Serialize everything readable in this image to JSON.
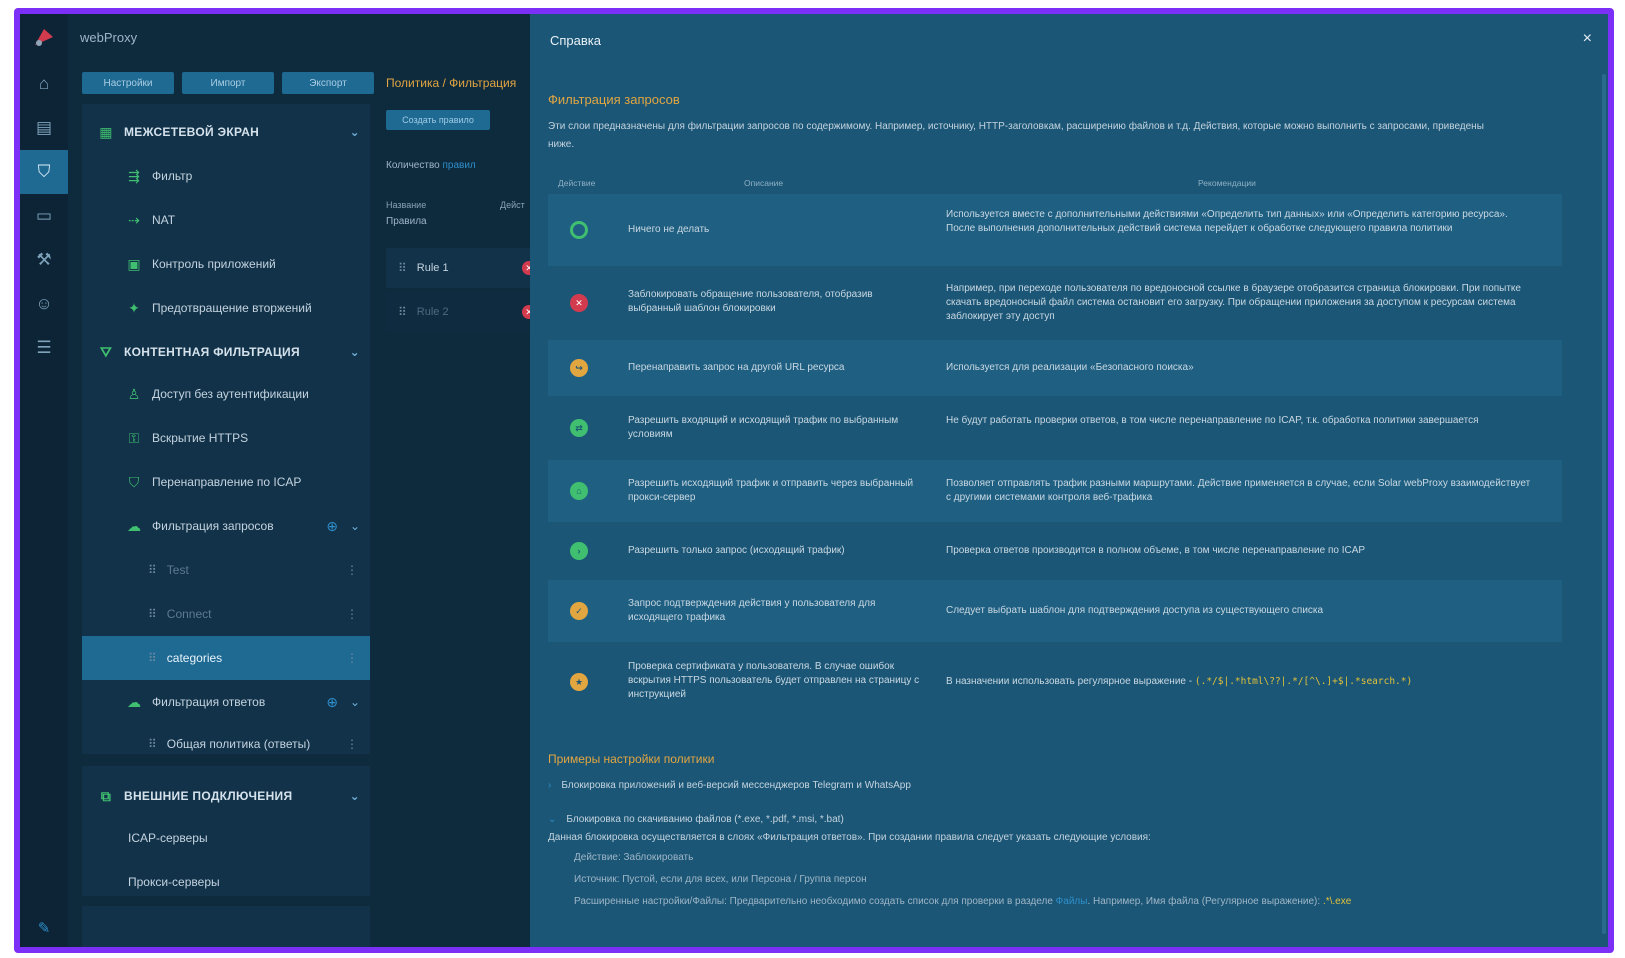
{
  "app": {
    "title": "webProxy"
  },
  "toolbar": {
    "settings": "Настройки",
    "import": "Импорт",
    "export": "Экспорт"
  },
  "nav": {
    "firewall": "МЕЖСЕТЕВОЙ ЭКРАН",
    "filter": "Фильтр",
    "nat": "NAT",
    "app_control": "Контроль приложений",
    "ips": "Предотвращение вторжений",
    "content_filter": "КОНТЕНТНАЯ ФИЛЬТРАЦИЯ",
    "no_auth": "Доступ без аутентификации",
    "https": "Вскрытие HTTPS",
    "icap": "Перенаправление по ICAP",
    "req_filter": "Фильтрация запросов",
    "rule_test": "Test",
    "rule_connect": "Connect",
    "rule_categories": "categories",
    "resp_filter": "Фильтрация ответов",
    "common_policy": "Общая политика (ответы)",
    "ext": "ВНЕШНИЕ ПОДКЛЮЧЕНИЯ",
    "icap_servers": "ICAP-серверы",
    "proxy_servers": "Прокси-серверы"
  },
  "middle": {
    "breadcrumb": "Политика / Фильтрация",
    "create_rule": "Создать правило",
    "count_label": "Количество",
    "count_link": "правил",
    "col_name": "Название",
    "col_action": "Дейст",
    "rules_label": "Правила",
    "rule1": "Rule 1",
    "rule2": "Rule 2"
  },
  "help": {
    "title": "Справка",
    "close": "×",
    "section": "Фильтрация запросов",
    "intro": "Эти слои предназначены для фильтрации запросов по содержимому. Например, источнику, HTTP-заголовкам, расширению файлов и т.д. Действия, которые можно выполнить с запросами, приведены ниже.",
    "th_action": "Действие",
    "th_desc": "Описание",
    "th_rec": "Рекомендации",
    "rows": [
      {
        "icon": "circle-icon",
        "color": "#3fbf6f",
        "desc": "Ничего не делать",
        "rec": "Используется вместе с дополнительными действиями «Определить тип данных» или «Определить категорию ресурса». После выполнения дополнительных действий система перейдет к обработке следующего правила политики"
      },
      {
        "icon": "block-icon",
        "color": "#d23b4e",
        "desc": "Заблокировать обращение пользователя, отобразив выбранный шаблон блокировки",
        "rec": "Например, при переходе пользователя по вредоносной ссылке в браузере отобразится страница блокировки. При попытке скачать вредоносный файл система остановит его загрузку. При обращении приложения за доступом к ресурсам система заблокирует эту доступ"
      },
      {
        "icon": "redirect-icon",
        "color": "#e2a641",
        "desc": "Перенаправить запрос на другой URL ресурса",
        "rec": "Используется для реализации «Безопасного поиска»"
      },
      {
        "icon": "allow-all-icon",
        "color": "#3fbf6f",
        "desc": "Разрешить входящий и исходящий трафик по выбранным условиям",
        "rec": "Не будут работать проверки ответов, в том числе перенаправление по ICAP, т.к. обработка политики завершается"
      },
      {
        "icon": "proxy-icon",
        "color": "#3fbf6f",
        "desc": "Разрешить исходящий трафик и отправить через выбранный прокси-сервер",
        "rec": "Позволяет отправлять трафик разными маршрутами. Действие применяется в случае, если Solar webProxy взаимодействует с другими системами контроля веб-трафика"
      },
      {
        "icon": "allow-request-icon",
        "color": "#3fbf6f",
        "desc": "Разрешить только запрос (исходящий трафик)",
        "rec": "Проверка ответов производится в полном объеме, в том числе перенаправление по ICAP"
      },
      {
        "icon": "confirm-icon",
        "color": "#e2a641",
        "desc": "Запрос подтверждения действия у пользователя для исходящего трафика",
        "rec": "Следует выбрать шаблон для подтверждения доступа из существующего списка"
      },
      {
        "icon": "certificate-icon",
        "color": "#e2a641",
        "desc": "Проверка сертификата у пользователя. В случае ошибок вскрытия HTTPS пользователь будет отправлен на страницу с инструкцией",
        "rec": "В назначении использовать регулярное выражение -",
        "code": "(.*/$|.*html\\??|.*/[^\\.]+$|.*search.*)"
      }
    ],
    "examples_title": "Примеры настройки политики",
    "ex1": "Блокировка приложений и веб-версий мессенджеров Telegram и WhatsApp",
    "ex2": "Блокировка по скачиванию файлов (*.exe, *.pdf, *.msi, *.bat)",
    "ex2_line": "Данная блокировка осуществляется в слоях «Фильтрация ответов». При создании правила следует указать следующие условия:",
    "ex2_action": "Действие: Заблокировать",
    "ex2_source": "Источник: Пустой, если для всех, или Персона / Группа персон",
    "ex2_ext_a": "Расширенные настройки/Файлы: Предварительно необходимо создать список для проверки в разделе",
    "ex2_ext_link": "Файлы",
    "ex2_ext_b": ". Например, Имя файла (Регулярное выражение):",
    "ex2_ext_code": ".*\\.exe"
  }
}
